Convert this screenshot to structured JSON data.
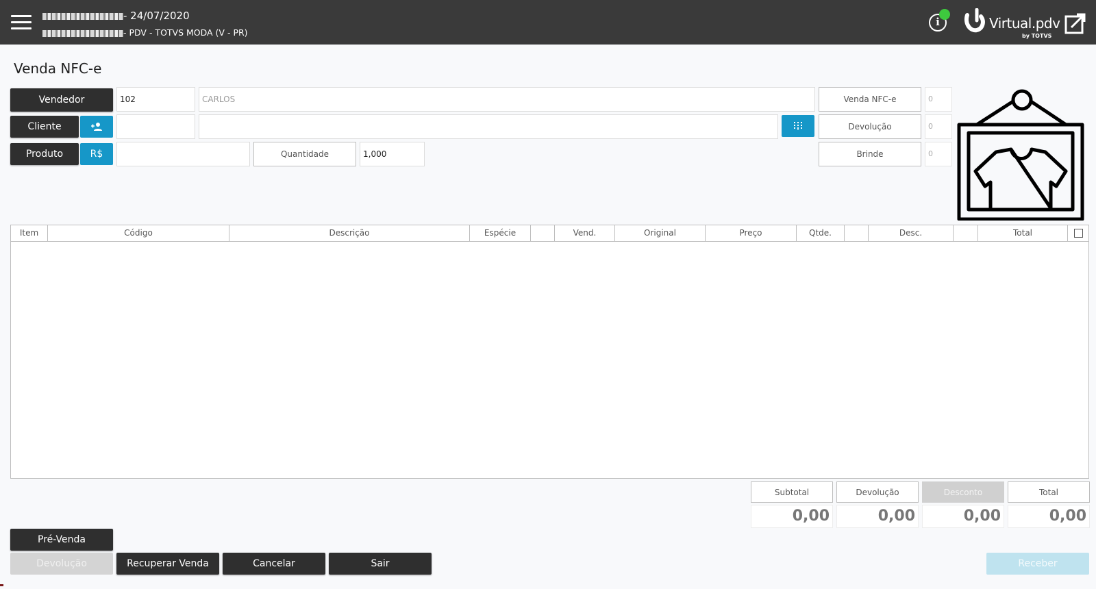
{
  "header": {
    "line1": "- 24/07/2020",
    "line2": "- PDV - TOTVS MODA (V - PR)",
    "logo_text": "Virtual.pdv",
    "logo_sub": "by TOTVS"
  },
  "page": {
    "title": "Venda NFC-e"
  },
  "form": {
    "vendedor_label": "Vendedor",
    "vendedor_code": "102",
    "vendedor_name": "CARLOS",
    "cliente_label": "Cliente",
    "cliente_code": "",
    "cliente_name": "",
    "produto_label": "Produto",
    "price_button": "R$",
    "produto_code": "",
    "quantidade_label": "Quantidade",
    "quantidade_value": "1,000"
  },
  "counters": [
    {
      "label": "Venda NFC-e",
      "value": "0"
    },
    {
      "label": "Devolução",
      "value": "0"
    },
    {
      "label": "Brinde",
      "value": "0"
    }
  ],
  "table": {
    "columns": [
      "Item",
      "Código",
      "Descrição",
      "Espécie",
      "",
      "Vend.",
      "Original",
      "Preço",
      "Qtde.",
      "",
      "Desc.",
      "",
      "Total"
    ],
    "rows": []
  },
  "totals": [
    {
      "label": "Subtotal",
      "value": "0,00"
    },
    {
      "label": "Devolução",
      "value": "0,00"
    },
    {
      "label": "Desconto",
      "value": "0,00"
    },
    {
      "label": "Total",
      "value": "0,00"
    }
  ],
  "actions": {
    "pre_venda": "Pré-Venda",
    "devolucao": "Devolução",
    "recuperar": "Recuperar Venda",
    "cancelar": "Cancelar",
    "sair": "Sair",
    "receber": "Receber"
  },
  "icons": {
    "menu": "hamburger-menu-icon",
    "info": "info-icon",
    "status": "online-status-dot",
    "expand": "expand-window-icon",
    "add_client": "add-person-icon",
    "keypad": "keypad-icon",
    "product_image": "shirt-frame-icon"
  },
  "colors": {
    "topbar": "#3a3a3a",
    "accent_blue": "#1697c8",
    "dark_button": "#2f2f2f",
    "status_online": "#3ec93e"
  }
}
